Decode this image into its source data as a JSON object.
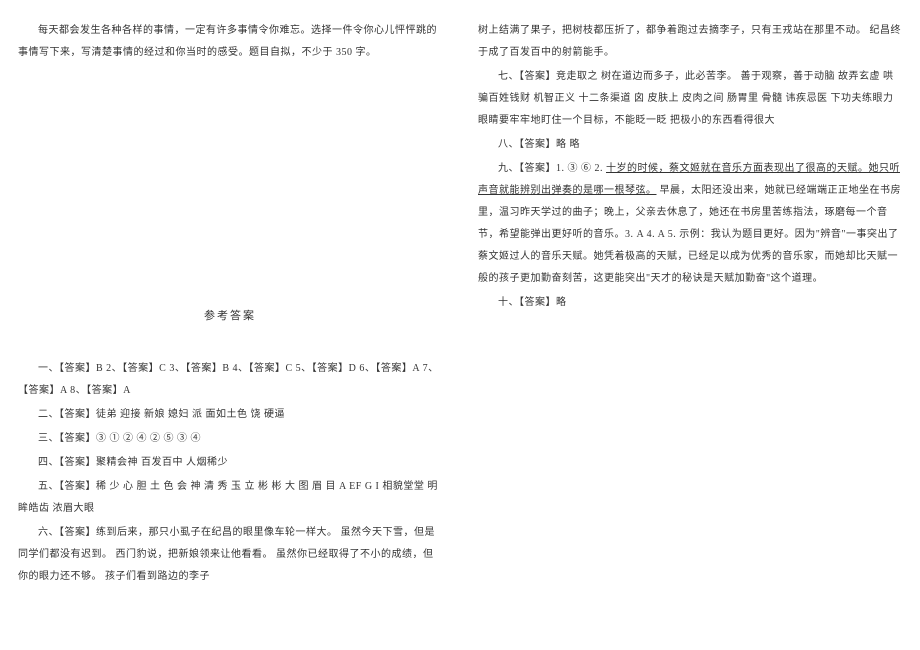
{
  "left": {
    "intro1": "每天都会发生各种各样的事情，一定有许多事情令你难忘。选择一件令你心儿怦怦跳的事情写下来，写清楚事情的经过和你当时的感受。题目自拟，不少于 350 字。",
    "section_title": "参考答案",
    "ans1": "一、【答案】B  2、【答案】C  3、【答案】B   4、【答案】C   5、【答案】D  6、【答案】A  7、【答案】A  8、【答案】A",
    "ans2": "二、【答案】徒弟     迎接     新娘     媳妇     派     面如土色     饶     硬逼",
    "ans3": "三、【答案】③    ①    ②    ④    ②    ⑤    ③    ④",
    "ans4": "四、【答案】聚精会神    百发百中    人烟稀少",
    "ans5": "五、【答案】稀    少    心    胆    土    色    会    神    清    秀    玉    立    彬    彬    大    图    眉    目    A    EF    G    I        相貌堂堂    明眸皓齿    浓眉大眼",
    "ans6": "六、【答案】练到后来，那只小虱子在纪昌的眼里像车轮一样大。    虽然今天下雪，但是同学们都没有迟到。    西门豹说，把新娘领来让他看看。    虽然你已经取得了不小的成绩，但你的眼力还不够。    孩子们看到路边的李子"
  },
  "right": {
    "cont6": "树上结满了果子，把树枝都压折了，都争着跑过去摘李子，只有王戎站在那里不动。    纪昌终于成了百发百中的射箭能手。",
    "ans7": "七、【答案】竞走取之   树在道边而多子，此必苦李。   善于观察，善于动脑   故弄玄虚   哄骗百姓钱财   机智正义    十二条渠道    囟   皮肤上   皮肉之间   肠胃里   骨髓   讳疾忌医   下功夫练眼力   眼睛要牢牢地盯住一个目标，不能眨一眨    把极小的东西看得很大",
    "ans8": "八、【答案】略    略",
    "ans9_pre": "九、【答案】1.   ③     ⑥     2. ",
    "ans9_u": "十岁的时候，蔡文姬就在音乐方面表现出了很高的天赋。她只听声音就能辨别出弹奏的是哪一根琴弦。",
    "ans9_post": "    早晨，太阳还没出来，她就已经端端正正地坐在书房里，温习昨天学过的曲子；晚上，父亲去休息了，她还在书房里苦练指法，琢磨每一个音节，希望能弹出更好听的音乐。3. A    4. A    5. 示例：我认为题目更好。因为\"辨音\"一事突出了蔡文姬过人的音乐天赋。她凭着极高的天赋，已经足以成为优秀的音乐家，而她却比天赋一般的孩子更加勤奋刻苦，这更能突出\"天才的秘诀是天赋加勤奋\"这个道理。",
    "ans10": "十、【答案】略"
  }
}
